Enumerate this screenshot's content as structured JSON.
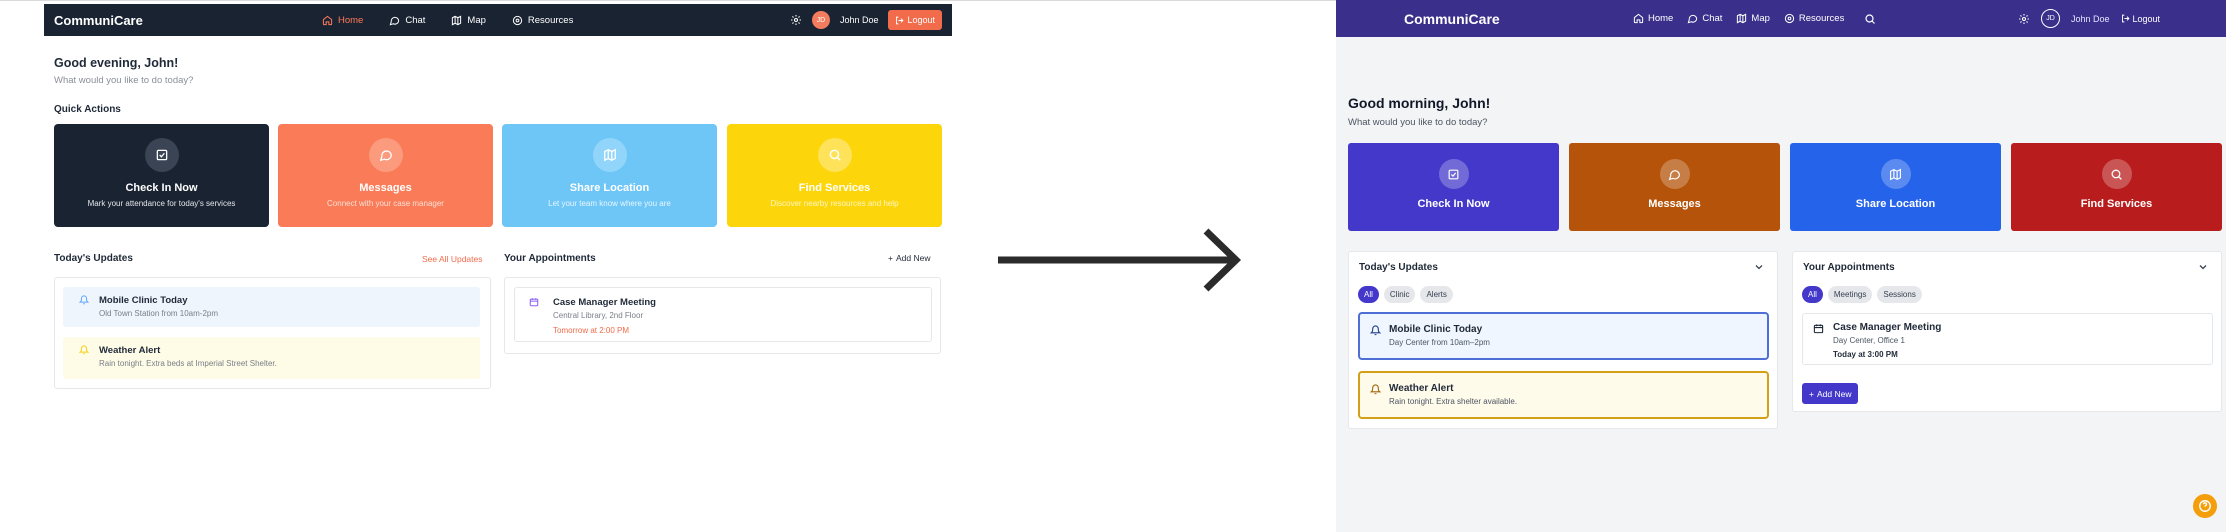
{
  "left": {
    "brand": "CommuniCare",
    "nav": [
      {
        "label": "Home",
        "icon": "home-icon",
        "active": true
      },
      {
        "label": "Chat",
        "icon": "chat-icon",
        "active": false
      },
      {
        "label": "Map",
        "icon": "map-icon",
        "active": false
      },
      {
        "label": "Resources",
        "icon": "resources-icon",
        "active": false
      }
    ],
    "user": {
      "initials": "JD",
      "name": "John Doe"
    },
    "logout": "Logout",
    "greeting": "Good evening, John!",
    "subtitle": "What would you like to do today?",
    "quick_actions_title": "Quick Actions",
    "actions": [
      {
        "title": "Check In Now",
        "desc": "Mark your attendance for today's services",
        "icon": "check-icon"
      },
      {
        "title": "Messages",
        "desc": "Connect with your case manager",
        "icon": "chat-icon"
      },
      {
        "title": "Share Location",
        "desc": "Let your team know where you are",
        "icon": "map-icon"
      },
      {
        "title": "Find Services",
        "desc": "Discover nearby resources and help",
        "icon": "search-icon"
      }
    ],
    "updates": {
      "title": "Today's Updates",
      "see_all": "See All Updates",
      "items": [
        {
          "title": "Mobile Clinic Today",
          "desc": "Old Town Station from 10am-2pm"
        },
        {
          "title": "Weather Alert",
          "desc": "Rain tonight. Extra beds at Imperial Street Shelter."
        }
      ]
    },
    "appointments": {
      "title": "Your Appointments",
      "add_new": "Add New",
      "items": [
        {
          "title": "Case Manager Meeting",
          "location": "Central Library, 2nd Floor",
          "when": "Tomorrow at 2:00 PM"
        }
      ]
    }
  },
  "right": {
    "brand": "CommuniCare",
    "nav": [
      {
        "label": "Home",
        "icon": "home-icon"
      },
      {
        "label": "Chat",
        "icon": "chat-icon"
      },
      {
        "label": "Map",
        "icon": "map-icon"
      },
      {
        "label": "Resources",
        "icon": "resources-icon"
      }
    ],
    "user": {
      "initials": "JD",
      "name": "John Doe"
    },
    "logout": "Logout",
    "greeting": "Good morning, John!",
    "subtitle": "What would you like to do today?",
    "actions": [
      {
        "title": "Check In Now",
        "icon": "check-icon",
        "color": "#4338ca"
      },
      {
        "title": "Messages",
        "icon": "chat-icon",
        "color": "#b45309"
      },
      {
        "title": "Share Location",
        "icon": "map-icon",
        "color": "#2563eb"
      },
      {
        "title": "Find Services",
        "icon": "search-icon",
        "color": "#b91c1c"
      }
    ],
    "updates": {
      "title": "Today's Updates",
      "tabs": [
        "All",
        "Clinic",
        "Alerts"
      ],
      "items": [
        {
          "title": "Mobile Clinic Today",
          "desc": "Day Center from 10am–2pm"
        },
        {
          "title": "Weather Alert",
          "desc": "Rain tonight. Extra shelter available."
        }
      ]
    },
    "appointments": {
      "title": "Your Appointments",
      "tabs": [
        "All",
        "Meetings",
        "Sessions"
      ],
      "items": [
        {
          "title": "Case Manager Meeting",
          "location": "Day Center, Office 1",
          "when": "Today at 3:00 PM"
        }
      ],
      "add_new": "Add New"
    }
  },
  "colors": {
    "left_nav_bg": "#1a2332",
    "left_accent": "#f26b4b",
    "right_nav_bg": "#3a2f8a",
    "right_accent": "#4338ca",
    "help_button": "#f59e0b"
  }
}
